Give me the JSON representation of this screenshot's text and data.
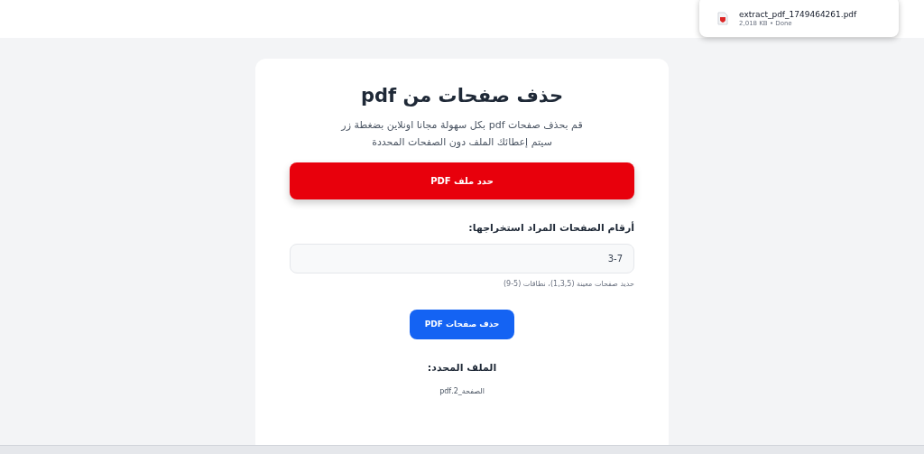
{
  "download": {
    "filename": "extract_pdf_1749464261.pdf",
    "meta": "2,018 KB • Done"
  },
  "card": {
    "title": "حذف صفحات من pdf",
    "description": [
      "قم بحذف صفحات pdf بكل سهولة مجانا اونلاين بضغطة زر",
      "سيتم إعطائك الملف دون الصفحات المحددة"
    ],
    "select_button": "حدد ملف PDF",
    "pages_label": "أرقام الصفحات المراد استخراجها:",
    "pages_value": "3-7",
    "hint": "حديد صفحات معينة (1,3,5)، نطاقات (5-9)",
    "delete_button": "حذف صفحات PDF",
    "selected_label": "الملف المحدد:",
    "selected_file": "الصفحة_2.pdf"
  }
}
